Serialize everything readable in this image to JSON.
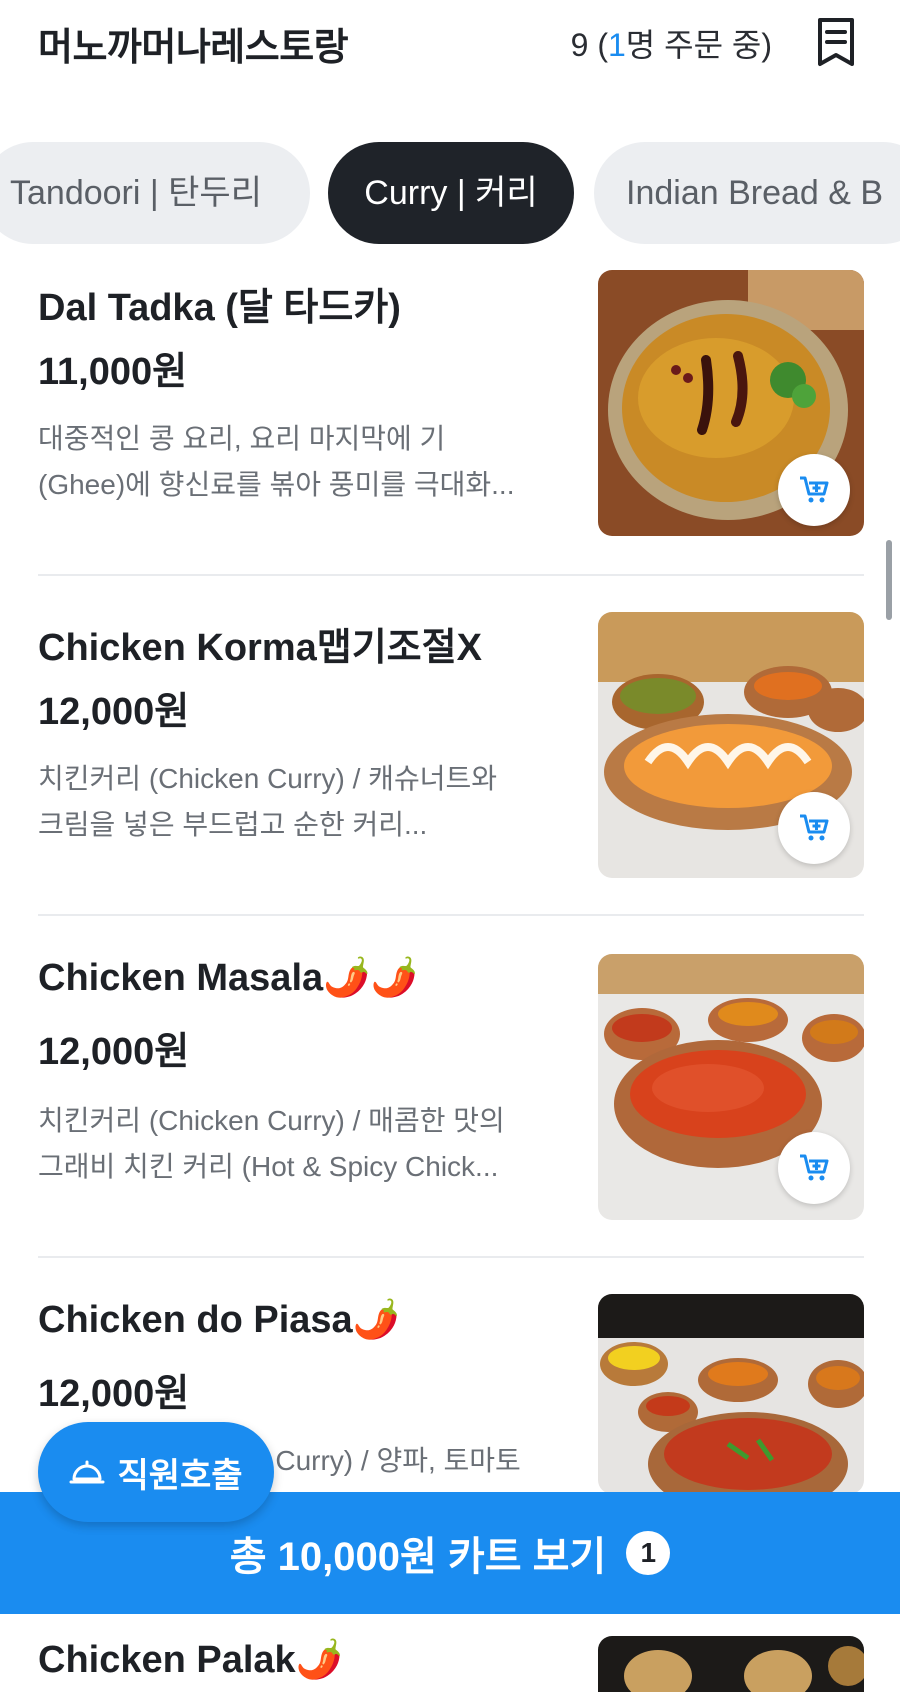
{
  "header": {
    "store_name": "머노까머나레스토랑",
    "table_number": "9",
    "orders_prefix": " (",
    "orders_count": "1",
    "orders_suffix": "명 주문 중)"
  },
  "tabs": [
    {
      "label": "Tandoori | 탄두리",
      "active": false
    },
    {
      "label": "Curry | 커리",
      "active": true
    },
    {
      "label": "Indian Bread & B",
      "active": false
    }
  ],
  "items": [
    {
      "name": "Dal Tadka (달 타드카)",
      "price": "11,000원",
      "desc_line1": "대중적인 콩 요리, 요리 마지막에 기",
      "desc_line2": "(Ghee)에 향신료를 볶아 풍미를 극대화...",
      "image_icon": "dal-curry-photo"
    },
    {
      "name": "Chicken Korma맵기조절X",
      "price": "12,000원",
      "desc_line1": "치킨커리 (Chicken Curry) / 캐슈너트와",
      "desc_line2": "크림을 넣은 부드럽고 순한 커리...",
      "image_icon": "korma-curry-photo"
    },
    {
      "name": "Chicken Masala🌶️🌶️",
      "price": "12,000원",
      "desc_line1": "치킨커리 (Chicken Curry) / 매콤한 맛의",
      "desc_line2": "그래비 치킨 커리 (Hot & Spicy Chick...",
      "image_icon": "masala-curry-photo"
    },
    {
      "name": "Chicken do Piasa🌶️",
      "price": "12,000원",
      "desc_line1": "n Curry) / 양파, 토마토",
      "desc_line2": "",
      "image_icon": "dopiaza-curry-photo"
    },
    {
      "name": "Chicken Palak🌶️",
      "price": "",
      "desc_line1": "",
      "desc_line2": "",
      "image_icon": "palak-curry-photo"
    }
  ],
  "staff_call": {
    "label": "직원호출",
    "icon": "bell-icon"
  },
  "cart_bar": {
    "label": "총 10,000원 카트 보기",
    "count": "1"
  },
  "colors": {
    "accent": "#1a8cf0",
    "dark": "#1f2329",
    "text": "#1e2126",
    "muted": "#6a6f76"
  }
}
